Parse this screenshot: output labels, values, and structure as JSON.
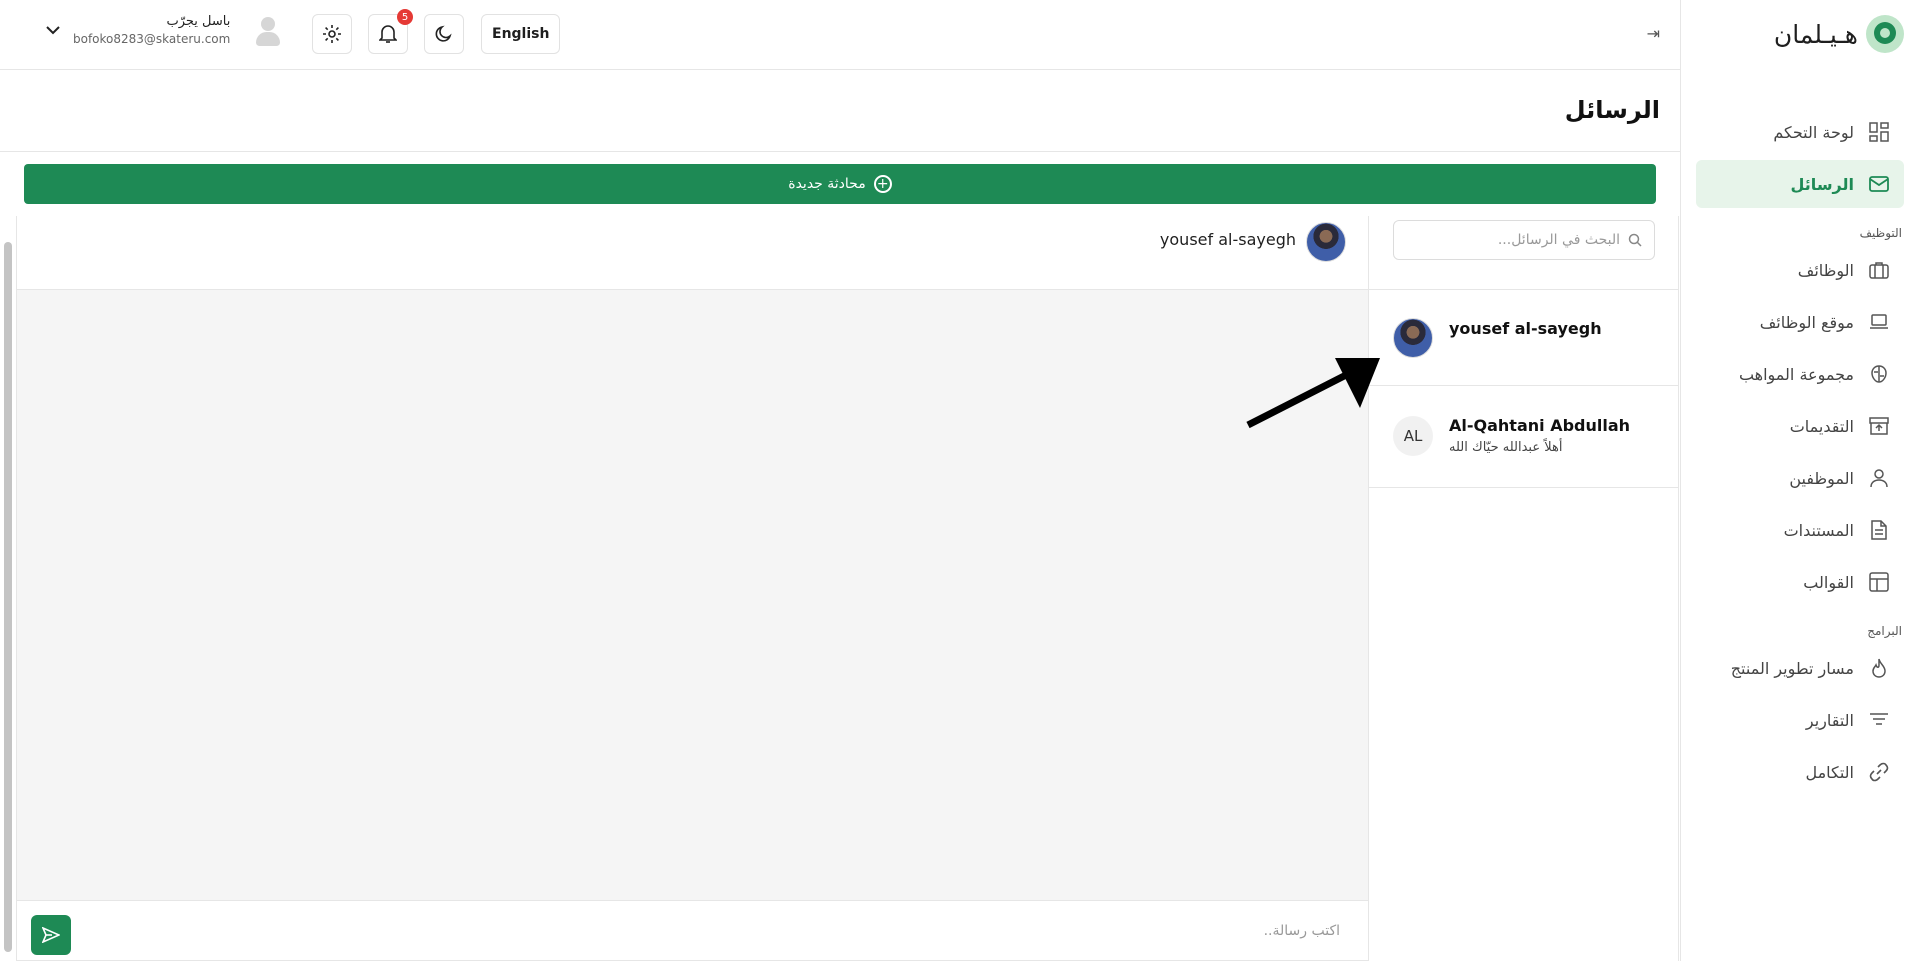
{
  "brand": {
    "name": "هـيـلمان"
  },
  "sidebar": {
    "items": [
      {
        "label": "لوحة التحكم",
        "icon": "dashboard-icon"
      },
      {
        "label": "الرسائل",
        "icon": "mail-icon"
      }
    ],
    "section_employment": "التوظيف",
    "employment_items": [
      {
        "label": "الوظائف",
        "icon": "briefcase-icon"
      },
      {
        "label": "موقع الوظائف",
        "icon": "laptop-icon"
      },
      {
        "label": "مجموعة المواهب",
        "icon": "brain-icon"
      },
      {
        "label": "التقديمات",
        "icon": "archive-icon"
      },
      {
        "label": "الموظفين",
        "icon": "user-icon"
      },
      {
        "label": "المستندات",
        "icon": "document-icon"
      },
      {
        "label": "القوالب",
        "icon": "layout-icon"
      }
    ],
    "section_programs": "البرامج",
    "program_items": [
      {
        "label": "مسار تطوير المنتج",
        "icon": "flame-icon"
      },
      {
        "label": "التقارير",
        "icon": "filter-icon"
      },
      {
        "label": "التكامل",
        "icon": "link-icon"
      }
    ]
  },
  "header": {
    "language_button": "English",
    "notifications_count": "5",
    "user_name": "باسل يجرّب",
    "user_email": "bofoko8283@skateru.com"
  },
  "page": {
    "title": "الرسائل",
    "new_chat_label": "محادثة جديدة"
  },
  "search": {
    "placeholder": "البحث في الرسائل..."
  },
  "conversations": [
    {
      "name": "yousef al-sayegh",
      "last_message": ""
    },
    {
      "name": "Al-Qahtani Abdullah",
      "initials": "AL",
      "last_message": "أهلاً عبدالله حيّاك الله"
    }
  ],
  "chat": {
    "contact_name": "yousef al-sayegh",
    "composer_placeholder": "اكتب رسالة.."
  },
  "colors": {
    "accent": "#1e8a55",
    "badge": "#e53935",
    "active_bg": "#e7f4ea"
  }
}
